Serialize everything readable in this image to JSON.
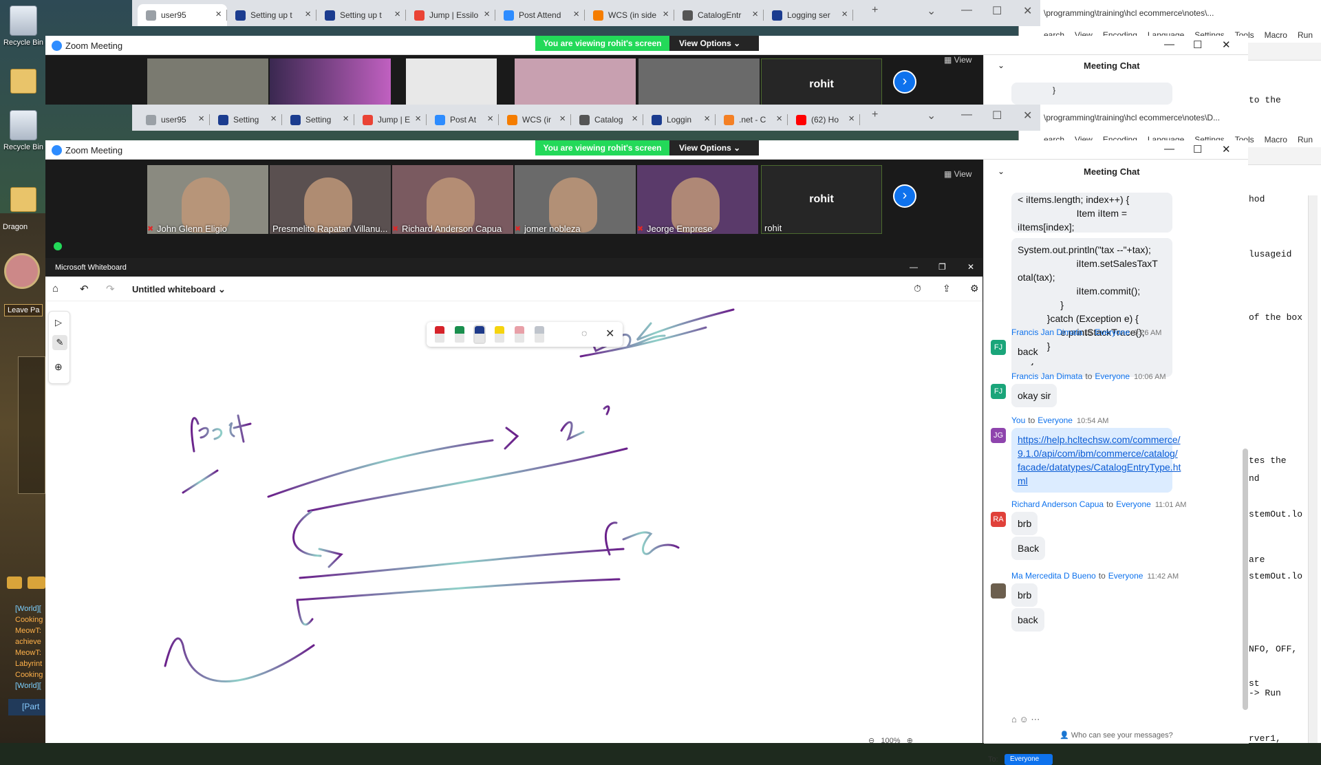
{
  "desktop": {
    "icons": [
      {
        "label": "Recycle Bin"
      },
      {
        "label": "Recycle Bin"
      },
      {
        "label": "Dragon"
      }
    ],
    "leave_label": "Leave Pa",
    "game_chat": [
      {
        "text": "[World][",
        "color": "blue"
      },
      {
        "text": "Cooking",
        "color": "orange"
      },
      {
        "text": "MeowT:",
        "color": "orange"
      },
      {
        "text": "achieve",
        "color": "orange"
      },
      {
        "text": "MeowT:",
        "color": "orange"
      },
      {
        "text": "Labyrint",
        "color": "orange"
      },
      {
        "text": "Cooking",
        "color": "orange"
      },
      {
        "text": "[World][",
        "color": "blue"
      }
    ],
    "party_label": "[Part"
  },
  "notepad": {
    "path_top": "\\programming\\training\\hcl ecommerce\\notes\\...",
    "path_bottom": "\\programming\\training\\hcl ecommerce\\notes\\D...",
    "menu": [
      "earch",
      "View",
      "Encoding",
      "Language",
      "Settings",
      "Tools",
      "Macro",
      "Run"
    ],
    "code_top": "to the",
    "code_lines": [
      "hod",
      "lusageid",
      "of the box",
      "tes the",
      "nd",
      "stemOut.lo",
      "are",
      "stemOut.lo",
      "NFO, OFF,",
      "st",
      " -> Run",
      "rver1,"
    ]
  },
  "chrome_top": {
    "tabs": [
      {
        "label": "user95",
        "fav": "#9aa0a6"
      },
      {
        "label": "Setting up t",
        "fav": "#1b3c8f"
      },
      {
        "label": "Setting up t",
        "fav": "#1b3c8f"
      },
      {
        "label": "Jump | Essilo",
        "fav": "#ea4335"
      },
      {
        "label": "Post Attend",
        "fav": "#2d8cff"
      },
      {
        "label": "WCS (in side",
        "fav": "#f57d00"
      },
      {
        "label": "CatalogEntr",
        "fav": "#555555"
      },
      {
        "label": "Logging ser",
        "fav": "#1b3c8f"
      }
    ]
  },
  "chrome_bottom": {
    "tabs": [
      {
        "label": "user95",
        "fav": "#9aa0a6"
      },
      {
        "label": "Setting",
        "fav": "#1b3c8f"
      },
      {
        "label": "Setting",
        "fav": "#1b3c8f"
      },
      {
        "label": "Jump | E",
        "fav": "#ea4335"
      },
      {
        "label": "Post At",
        "fav": "#2d8cff"
      },
      {
        "label": "WCS (ir",
        "fav": "#f57d00"
      },
      {
        "label": "Catalog",
        "fav": "#555555"
      },
      {
        "label": "Loggin",
        "fav": "#1b3c8f"
      },
      {
        "label": ".net - C",
        "fav": "#f48024"
      },
      {
        "label": "(62) Ho",
        "fav": "#ff0000"
      }
    ]
  },
  "zoom": {
    "title": "Zoom Meeting",
    "viewing_banner": "You are viewing rohit's screen",
    "view_options": "View Options",
    "view_label": "View",
    "participants": [
      {
        "name": "John Glenn Eligio",
        "muted": true,
        "bg": "#8a8a80"
      },
      {
        "name": "Presmelito Rapatan Villanu...",
        "muted": false,
        "bg": "#5a5050"
      },
      {
        "name": "Richard Anderson Capua",
        "muted": true,
        "bg": "#7a5a60"
      },
      {
        "name": "jomer nobleza",
        "muted": true,
        "bg": "#6a6a6a"
      },
      {
        "name": "Jeorge Emprese",
        "muted": true,
        "bg": "#5a3a6a"
      },
      {
        "name": "rohit",
        "muted": false,
        "bg": "#262626"
      }
    ],
    "active_speaker": "rohit"
  },
  "chat": {
    "title": "Meeting Chat",
    "code_snippet": [
      "< iItems.length; index++) {",
      "                      Item iItem =",
      "iItems[index];",
      "",
      "System.out.println(\"tax --\"+tax);",
      "                      iItem.setSalesTaxT",
      "otal(tax);",
      "                      iItem.commit();",
      "                }",
      "           }catch (Exception e) {",
      "                e.printStackTrace();",
      "           }",
      "     }"
    ],
    "top_snippet_brace": "}",
    "messages": [
      {
        "initials": "FJ",
        "color": "#1aa57a",
        "from": "Francis Jan Dimata",
        "to_word": "to",
        "to": "Everyone",
        "time": "9:26 AM",
        "texts": [
          "back"
        ]
      },
      {
        "initials": "FJ",
        "color": "#1aa57a",
        "from": "Francis Jan Dimata",
        "to_word": "to",
        "to": "Everyone",
        "time": "10:06 AM",
        "texts": [
          "okay sir"
        ]
      },
      {
        "initials": "JG",
        "color": "#8e44ad",
        "from": "You",
        "to_word": "to",
        "to": "Everyone",
        "time": "10:54 AM",
        "link": [
          "https://help.hcltechsw.com/commerce/",
          "9.1.0/api/com/ibm/commerce/catalog/",
          "facade/datatypes/CatalogEntryType.ht",
          "ml"
        ]
      },
      {
        "initials": "RA",
        "color": "#e0413a",
        "from": "Richard Anderson Capua",
        "to_word": "to",
        "to": "Everyone",
        "time": "11:01 AM",
        "texts": [
          "brb",
          "Back"
        ]
      },
      {
        "initials": "",
        "color": "#6c5f4e",
        "from": "Ma Mercedita D Bueno",
        "to_word": "to",
        "to": "Everyone",
        "time": "11:42 AM",
        "texts": [
          "brb",
          "back"
        ]
      }
    ],
    "who_can_see": "Who can see your messages?",
    "to_label": "To:",
    "to_target": "Everyone"
  },
  "whiteboard": {
    "app_title": "Microsoft Whiteboard",
    "board_title": "Untitled whiteboard",
    "zoom_level": "100%",
    "pen_colors": [
      "#d6232a",
      "#1a8f4e",
      "#1e3a8a",
      "#f5d40f",
      "#e8a0a8",
      "#bfc4cc"
    ],
    "word_post": "Post",
    "word_ce": "Ce"
  }
}
